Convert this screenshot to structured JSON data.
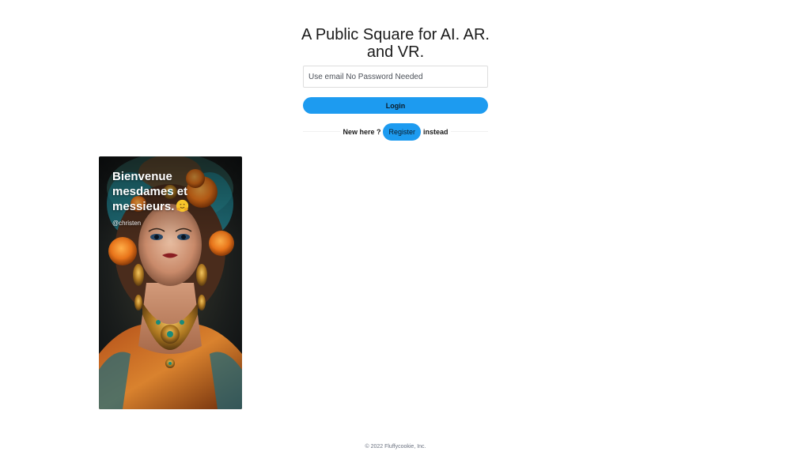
{
  "headline": "A Public Square for AI. AR. and VR.",
  "login": {
    "email_placeholder": "Use email No Password Needed",
    "email_value": "",
    "login_label": "Login"
  },
  "register": {
    "prefix": "New here ?",
    "button_label": "Register",
    "suffix": "instead"
  },
  "card": {
    "title": "Bienvenue mesdames et messieurs.",
    "emoji_icon": "hugging-face-icon",
    "author": "@christen"
  },
  "footer": {
    "copyright": "© 2022 Fluffycookie, Inc."
  },
  "colors": {
    "accent": "#1d9bf0",
    "background": "#ffffff",
    "footer_text": "#6b7280"
  }
}
